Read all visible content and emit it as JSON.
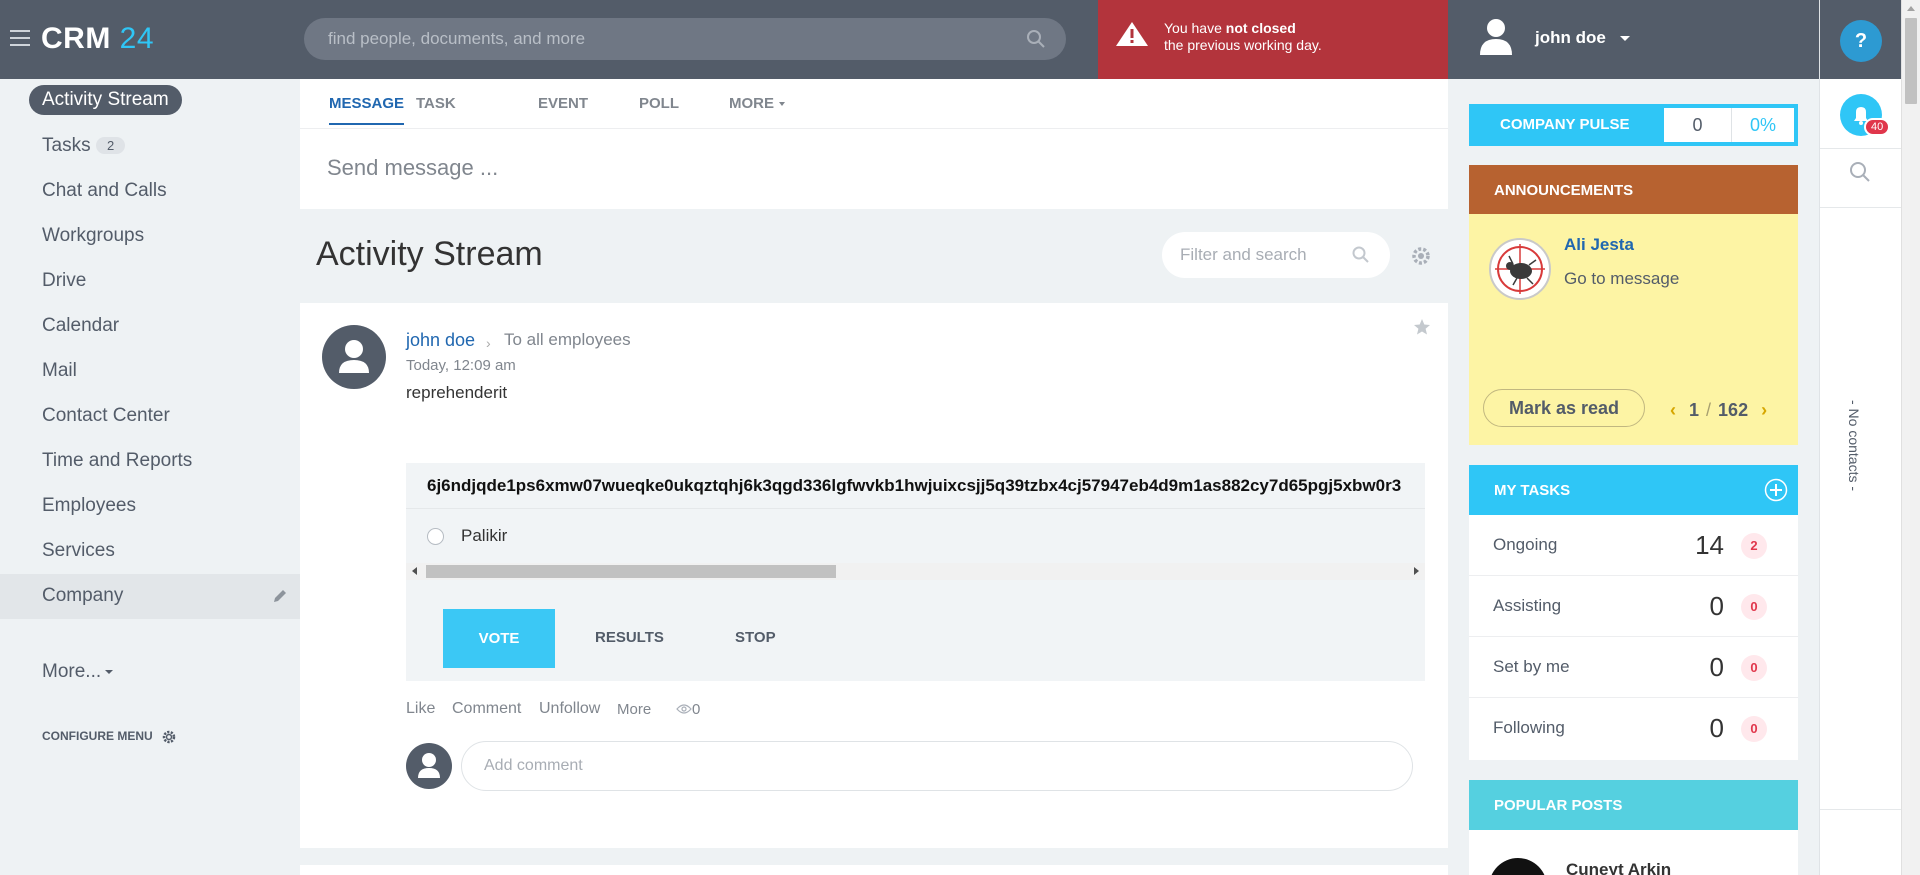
{
  "header": {
    "logo_text": "CRM",
    "logo_num": "24",
    "search_placeholder": "find people, documents, and more",
    "alert_line1_a": "You have ",
    "alert_line1_b": "not closed",
    "alert_line2": "the previous working day.",
    "user_name": "john doe"
  },
  "rightbar": {
    "help_label": "?",
    "notif_count": "40",
    "no_contacts": "- No contacts -"
  },
  "nav": {
    "items": [
      {
        "label": "Activity Stream"
      },
      {
        "label": "Tasks",
        "badge": "2"
      },
      {
        "label": "Chat and Calls"
      },
      {
        "label": "Workgroups"
      },
      {
        "label": "Drive"
      },
      {
        "label": "Calendar"
      },
      {
        "label": "Mail"
      },
      {
        "label": "Contact Center"
      },
      {
        "label": "Time and Reports"
      },
      {
        "label": "Employees"
      },
      {
        "label": "Services"
      },
      {
        "label": "Company"
      }
    ],
    "more_label": "More...",
    "configure_label": "CONFIGURE MENU"
  },
  "composer": {
    "tabs": [
      "MESSAGE",
      "TASK",
      "EVENT",
      "POLL",
      "MORE"
    ],
    "placeholder": "Send message ..."
  },
  "stream": {
    "title": "Activity Stream",
    "filter_placeholder": "Filter and search"
  },
  "post": {
    "author": "john doe",
    "arrow": "›",
    "destination": "To all employees",
    "time": "Today, 12:09 am",
    "text": "reprehenderit",
    "poll_question": "6j6ndjqde1ps6xmw07wueqke0ukqztqhj6k3qgd336lgfwvkb1hwjuixcsjj5q39tzbx4cj57947eb4d9m1as882cy7d65pgj5xbw0r3",
    "answer": "Palikir",
    "vote_label": "VOTE",
    "results_label": "RESULTS",
    "stop_label": "STOP",
    "actions": [
      "Like",
      "Comment",
      "Unfollow",
      "More"
    ],
    "views": "0",
    "comment_placeholder": "Add comment"
  },
  "pulse": {
    "title": "COMPANY PULSE",
    "value": "0",
    "percent": "0%"
  },
  "announcements": {
    "title": "ANNOUNCEMENTS",
    "name": "Ali Jesta",
    "link": "Go to message",
    "mark_label": "Mark as read",
    "page": "1",
    "sep": "/",
    "total": "162"
  },
  "tasks": {
    "title": "MY TASKS",
    "rows": [
      {
        "label": "Ongoing",
        "count": "14",
        "badge": "2"
      },
      {
        "label": "Assisting",
        "count": "0",
        "badge": "0"
      },
      {
        "label": "Set by me",
        "count": "0",
        "badge": "0"
      },
      {
        "label": "Following",
        "count": "0",
        "badge": "0"
      }
    ]
  },
  "popular": {
    "title": "POPULAR POSTS",
    "name": "Cuneyt Arkin"
  },
  "colors": {
    "header": "#535c69",
    "accent": "#2fc6f6",
    "alert": "#b3343c",
    "link": "#2067b0",
    "announcement_bg": "#fdf4a4",
    "announcement_header": "#b76230"
  }
}
